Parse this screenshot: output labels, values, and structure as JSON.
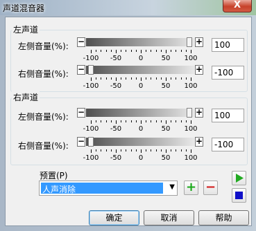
{
  "window": {
    "title": "声道混音器",
    "close_glyph": "X"
  },
  "groups": [
    {
      "title": "左声道",
      "rows": [
        {
          "label": "左侧音量(%):",
          "value": "100",
          "level": 100
        },
        {
          "label": "右侧音量(%):",
          "value": "-100",
          "level": -100
        }
      ]
    },
    {
      "title": "右声道",
      "rows": [
        {
          "label": "左侧音量(%):",
          "value": "100",
          "level": 100
        },
        {
          "label": "右侧音量(%):",
          "value": "-100",
          "level": -100
        }
      ]
    }
  ],
  "slider": {
    "minus_glyph": "−",
    "plus_glyph": "+",
    "tick_labels": [
      "-100",
      "-50",
      "0",
      "50",
      "100"
    ],
    "range": [
      -100,
      100
    ]
  },
  "presets": {
    "label": "预置(P)",
    "selected": "人声消除",
    "add_glyph": "+",
    "remove_glyph": "−",
    "play_icon": "play-icon",
    "stop_icon": "stop-icon"
  },
  "buttons": {
    "ok": "确定",
    "cancel": "取消",
    "help": "帮助"
  },
  "colors": {
    "selection": "#3399ff",
    "add_green": "#18a818",
    "remove_red": "#d21a1a",
    "play_green": "#22aa22",
    "stop_blue": "#1010c8"
  }
}
